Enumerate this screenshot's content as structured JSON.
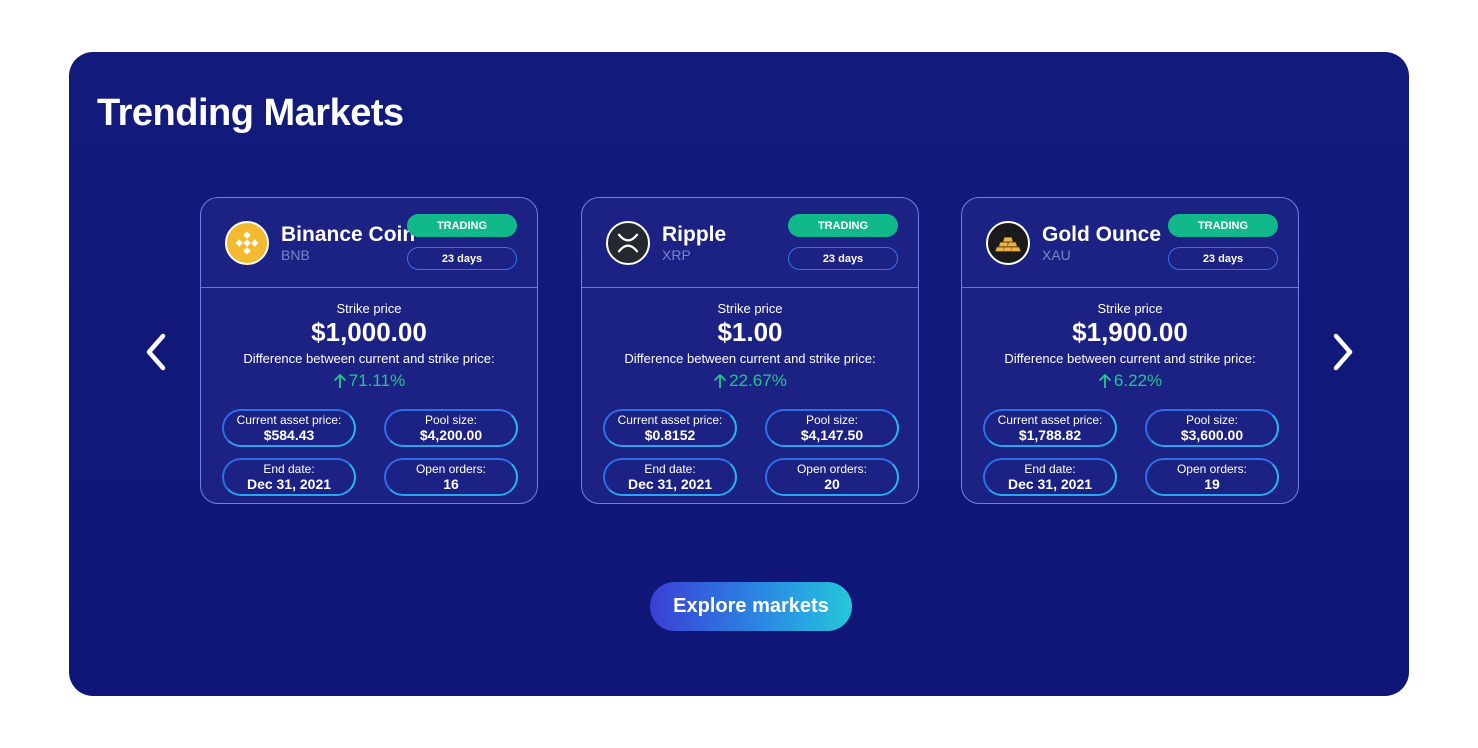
{
  "section": {
    "title": "Trending Markets",
    "explore_label": "Explore markets"
  },
  "labels": {
    "strike": "Strike price",
    "difference": "Difference between current and strike price:",
    "current_asset_price": "Current asset price:",
    "pool_size": "Pool size:",
    "end_date": "End date:",
    "open_orders": "Open orders:"
  },
  "colors": {
    "panel_background": "#10187a",
    "trading_badge": "#11b98a",
    "positive_change": "#20c98a",
    "card_border": "#6e7fe9"
  },
  "icons": {
    "prev": "chevron-left-icon",
    "next": "chevron-right-icon",
    "up": "arrow-up-icon"
  },
  "cards": [
    {
      "name": "Binance Coin",
      "ticker": "BNB",
      "icon": "bnb-logo-icon",
      "status": "TRADING",
      "duration": "23 days",
      "strike_price": "$1,000.00",
      "difference": "71.11%",
      "current_asset_price": "$584.43",
      "pool_size": "$4,200.00",
      "end_date": "Dec 31, 2021",
      "open_orders": "16"
    },
    {
      "name": "Ripple",
      "ticker": "XRP",
      "icon": "xrp-logo-icon",
      "status": "TRADING",
      "duration": "23 days",
      "strike_price": "$1.00",
      "difference": "22.67%",
      "current_asset_price": "$0.8152",
      "pool_size": "$4,147.50",
      "end_date": "Dec 31, 2021",
      "open_orders": "20"
    },
    {
      "name": "Gold Ounce",
      "ticker": "XAU",
      "icon": "gold-bars-icon",
      "status": "TRADING",
      "duration": "23 days",
      "strike_price": "$1,900.00",
      "difference": "6.22%",
      "current_asset_price": "$1,788.82",
      "pool_size": "$3,600.00",
      "end_date": "Dec 31, 2021",
      "open_orders": "19"
    }
  ]
}
